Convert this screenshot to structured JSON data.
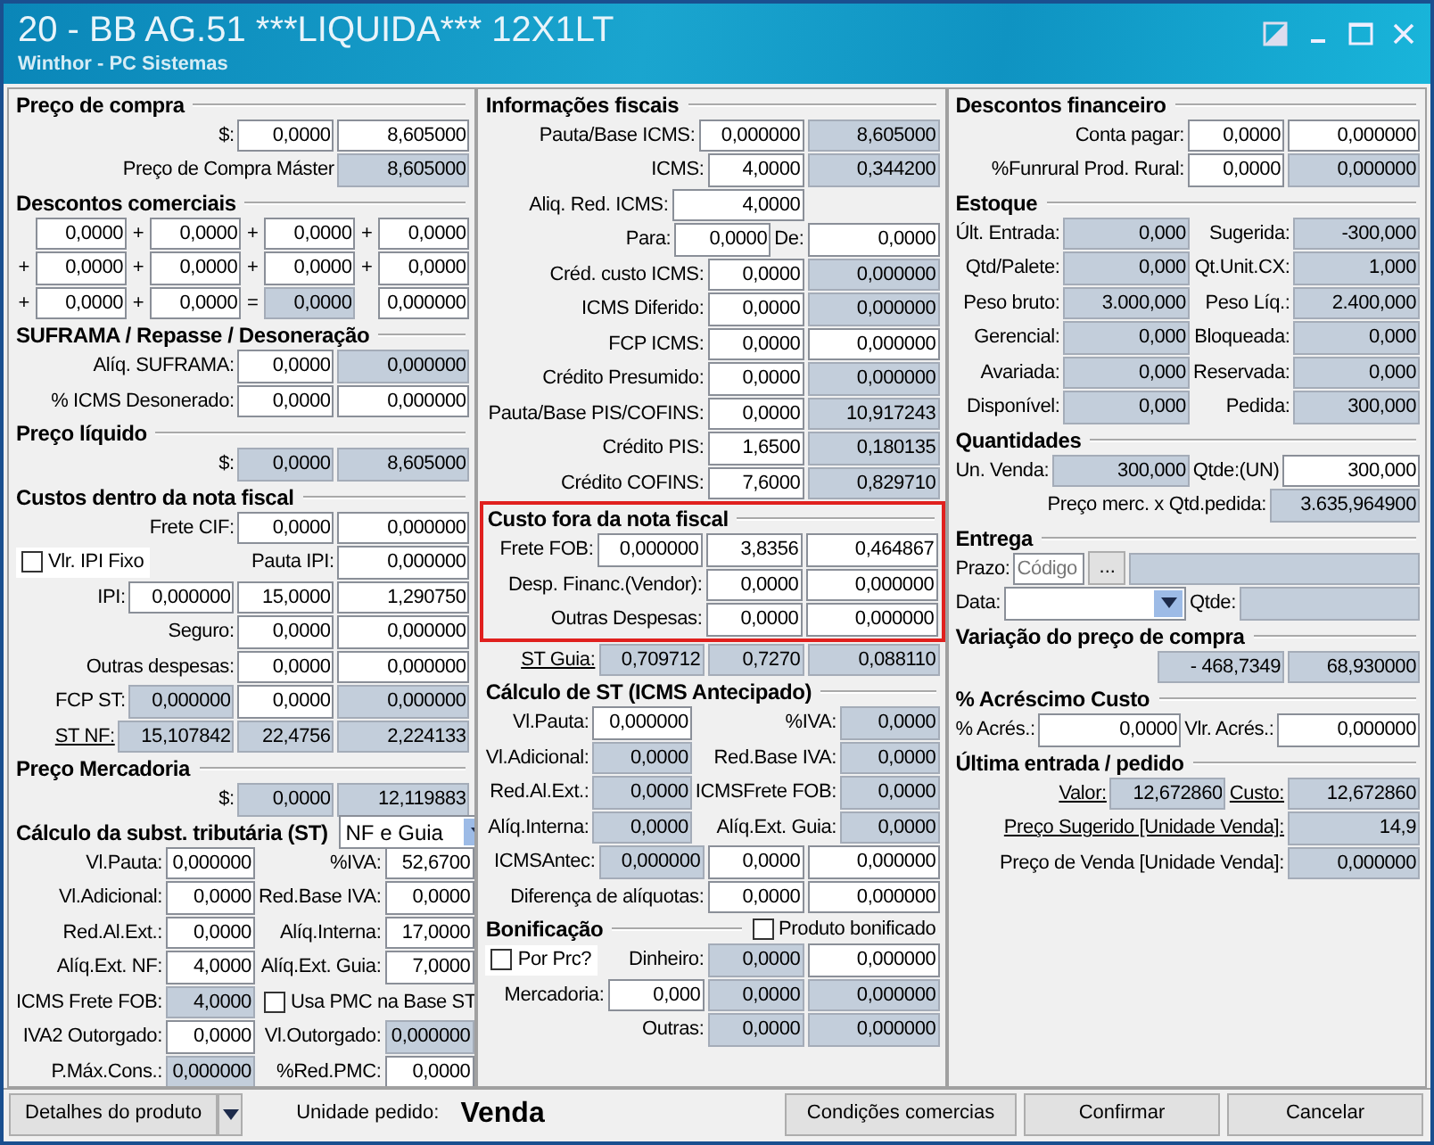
{
  "window": {
    "title": "20 - BB AG.51 ***LIQUIDA*** 12X1LT",
    "subtitle": "Winthor - PC Sistemas"
  },
  "columns": [
    {
      "sections": [
        {
          "title": "Preço de compra",
          "lines": [
            {
              "items": [
                {
                  "kind": "label",
                  "text": "$:"
                },
                {
                  "kind": "field",
                  "value": "0,0000",
                  "readonly": false
                },
                {
                  "kind": "field",
                  "value": "8,605000",
                  "readonly": false
                }
              ]
            },
            {
              "items": [
                {
                  "kind": "label",
                  "text": "Preço de Compra Máster"
                },
                {
                  "kind": "field",
                  "value": "8,605000",
                  "readonly": true
                }
              ]
            }
          ]
        },
        {
          "title": "Descontos comerciais",
          "lines": [
            {
              "items": [
                {
                  "kind": "field",
                  "value": "0,0000",
                  "readonly": false
                },
                {
                  "kind": "op",
                  "text": "+"
                },
                {
                  "kind": "field",
                  "value": "0,0000",
                  "readonly": false
                },
                {
                  "kind": "op",
                  "text": "+"
                },
                {
                  "kind": "field",
                  "value": "0,0000",
                  "readonly": false
                },
                {
                  "kind": "op",
                  "text": "+"
                },
                {
                  "kind": "field",
                  "value": "0,0000",
                  "readonly": false
                }
              ]
            },
            {
              "items": [
                {
                  "kind": "op",
                  "text": "+"
                },
                {
                  "kind": "field",
                  "value": "0,0000",
                  "readonly": false
                },
                {
                  "kind": "op",
                  "text": "+"
                },
                {
                  "kind": "field",
                  "value": "0,0000",
                  "readonly": false
                },
                {
                  "kind": "op",
                  "text": "+"
                },
                {
                  "kind": "field",
                  "value": "0,0000",
                  "readonly": false
                },
                {
                  "kind": "op",
                  "text": "+"
                },
                {
                  "kind": "field",
                  "value": "0,0000",
                  "readonly": false
                }
              ]
            },
            {
              "items": [
                {
                  "kind": "op",
                  "text": "+"
                },
                {
                  "kind": "field",
                  "value": "0,0000",
                  "readonly": false
                },
                {
                  "kind": "op",
                  "text": "+"
                },
                {
                  "kind": "field",
                  "value": "0,0000",
                  "readonly": false
                },
                {
                  "kind": "op",
                  "text": "="
                },
                {
                  "kind": "field",
                  "value": "0,0000",
                  "readonly": true
                },
                {
                  "kind": "field",
                  "value": "0,000000",
                  "readonly": false
                }
              ]
            }
          ]
        },
        {
          "title": "SUFRAMA / Repasse / Desoneração",
          "lines": [
            {
              "items": [
                {
                  "kind": "label",
                  "text": "Alíq. SUFRAMA:"
                },
                {
                  "kind": "field",
                  "value": "0,0000",
                  "readonly": false
                },
                {
                  "kind": "field",
                  "value": "0,000000",
                  "readonly": true
                }
              ]
            },
            {
              "items": [
                {
                  "kind": "label",
                  "text": "% ICMS Desonerado:"
                },
                {
                  "kind": "field",
                  "value": "0,0000",
                  "readonly": false
                },
                {
                  "kind": "field",
                  "value": "0,000000",
                  "readonly": false
                }
              ]
            }
          ]
        },
        {
          "title": "Preço líquido",
          "lines": [
            {
              "items": [
                {
                  "kind": "label",
                  "text": "$:"
                },
                {
                  "kind": "field",
                  "value": "0,0000",
                  "readonly": true
                },
                {
                  "kind": "field",
                  "value": "8,605000",
                  "readonly": true
                }
              ]
            }
          ]
        },
        {
          "title": "Custos dentro da nota fiscal",
          "lines": [
            {
              "items": [
                {
                  "kind": "label",
                  "text": "Frete CIF:"
                },
                {
                  "kind": "field",
                  "value": "0,0000",
                  "readonly": false
                },
                {
                  "kind": "field",
                  "value": "0,000000",
                  "readonly": false
                }
              ]
            },
            {
              "items": [
                {
                  "kind": "check",
                  "text": "Vlr. IPI Fixo",
                  "checked": false
                },
                {
                  "kind": "label",
                  "text": "Pauta IPI:"
                },
                {
                  "kind": "field",
                  "value": "0,000000",
                  "readonly": false
                }
              ]
            },
            {
              "items": [
                {
                  "kind": "label",
                  "text": "IPI:"
                },
                {
                  "kind": "field",
                  "value": "0,000000",
                  "readonly": false
                },
                {
                  "kind": "field",
                  "value": "15,0000",
                  "readonly": false
                },
                {
                  "kind": "field",
                  "value": "1,290750",
                  "readonly": false
                }
              ]
            },
            {
              "items": [
                {
                  "kind": "label",
                  "text": "Seguro:"
                },
                {
                  "kind": "field",
                  "value": "0,0000",
                  "readonly": false
                },
                {
                  "kind": "field",
                  "value": "0,000000",
                  "readonly": false
                }
              ]
            },
            {
              "items": [
                {
                  "kind": "label",
                  "text": "Outras despesas:"
                },
                {
                  "kind": "field",
                  "value": "0,0000",
                  "readonly": false
                },
                {
                  "kind": "field",
                  "value": "0,000000",
                  "readonly": false
                }
              ]
            },
            {
              "items": [
                {
                  "kind": "label",
                  "text": "FCP ST:"
                },
                {
                  "kind": "field",
                  "value": "0,000000",
                  "readonly": true
                },
                {
                  "kind": "field",
                  "value": "0,0000",
                  "readonly": false
                },
                {
                  "kind": "field",
                  "value": "0,000000",
                  "readonly": true
                }
              ]
            },
            {
              "items": [
                {
                  "kind": "link",
                  "text": "ST NF:"
                },
                {
                  "kind": "field",
                  "value": "15,107842",
                  "readonly": true
                },
                {
                  "kind": "field",
                  "value": "22,4756",
                  "readonly": true
                },
                {
                  "kind": "field",
                  "value": "2,224133",
                  "readonly": true
                }
              ]
            }
          ]
        },
        {
          "title": "Preço Mercadoria",
          "lines": [
            {
              "items": [
                {
                  "kind": "label",
                  "text": "$:"
                },
                {
                  "kind": "field",
                  "value": "0,0000",
                  "readonly": true
                },
                {
                  "kind": "field",
                  "value": "12,119883",
                  "readonly": true
                }
              ]
            }
          ]
        },
        {
          "title": "Cálculo da subst. tributária (ST)",
          "combo": "NF e Guia",
          "lines": [
            {
              "items": [
                {
                  "kind": "label",
                  "text": "Vl.Pauta:"
                },
                {
                  "kind": "field",
                  "value": "0,000000",
                  "readonly": false
                },
                {
                  "kind": "label",
                  "text": "%IVA:"
                },
                {
                  "kind": "field",
                  "value": "52,6700",
                  "readonly": false
                }
              ]
            },
            {
              "items": [
                {
                  "kind": "label",
                  "text": "Vl.Adicional:"
                },
                {
                  "kind": "field",
                  "value": "0,0000",
                  "readonly": false
                },
                {
                  "kind": "label",
                  "text": "Red.Base IVA:"
                },
                {
                  "kind": "field",
                  "value": "0,0000",
                  "readonly": false
                }
              ]
            },
            {
              "items": [
                {
                  "kind": "label",
                  "text": "Red.Al.Ext.:"
                },
                {
                  "kind": "field",
                  "value": "0,0000",
                  "readonly": false
                },
                {
                  "kind": "label",
                  "text": "Alíq.Interna:"
                },
                {
                  "kind": "field",
                  "value": "17,0000",
                  "readonly": false
                }
              ]
            },
            {
              "items": [
                {
                  "kind": "label",
                  "text": "Alíq.Ext. NF:"
                },
                {
                  "kind": "field",
                  "value": "4,0000",
                  "readonly": false
                },
                {
                  "kind": "label",
                  "text": "Alíq.Ext. Guia:"
                },
                {
                  "kind": "field",
                  "value": "7,0000",
                  "readonly": false
                }
              ]
            },
            {
              "items": [
                {
                  "kind": "label",
                  "text": "ICMS Frete FOB:"
                },
                {
                  "kind": "field",
                  "value": "4,0000",
                  "readonly": true
                },
                {
                  "kind": "check",
                  "text": "Usa PMC na Base ST",
                  "checked": false
                }
              ]
            },
            {
              "items": [
                {
                  "kind": "label",
                  "text": "IVA2 Outorgado:"
                },
                {
                  "kind": "field",
                  "value": "0,0000",
                  "readonly": false
                },
                {
                  "kind": "label",
                  "text": "Vl.Outorgado:"
                },
                {
                  "kind": "field",
                  "value": "0,000000",
                  "readonly": true
                }
              ]
            },
            {
              "items": [
                {
                  "kind": "label",
                  "text": "P.Máx.Cons.:"
                },
                {
                  "kind": "field",
                  "value": "0,000000",
                  "readonly": true
                },
                {
                  "kind": "label",
                  "text": "%Red.PMC:"
                },
                {
                  "kind": "field",
                  "value": "0,0000",
                  "readonly": false
                }
              ]
            }
          ]
        }
      ]
    },
    {
      "sections": [
        {
          "title": "Informações fiscais",
          "lines": [
            {
              "items": [
                {
                  "kind": "label",
                  "text": "Pauta/Base ICMS:"
                },
                {
                  "kind": "field",
                  "value": "0,000000",
                  "readonly": false
                },
                {
                  "kind": "field",
                  "value": "8,605000",
                  "readonly": true
                }
              ]
            },
            {
              "items": [
                {
                  "kind": "label",
                  "text": "ICMS:"
                },
                {
                  "kind": "field",
                  "value": "4,0000",
                  "readonly": false
                },
                {
                  "kind": "field",
                  "value": "0,344200",
                  "readonly": true
                }
              ]
            },
            {
              "items": [
                {
                  "kind": "label",
                  "text": "Aliq. Red. ICMS:"
                },
                {
                  "kind": "field",
                  "value": "4,0000",
                  "readonly": false
                }
              ]
            },
            {
              "items": [
                {
                  "kind": "label",
                  "text": "Para:"
                },
                {
                  "kind": "field",
                  "value": "0,0000",
                  "readonly": false
                },
                {
                  "kind": "label",
                  "text": "De:"
                },
                {
                  "kind": "field",
                  "value": "0,0000",
                  "readonly": false
                }
              ]
            },
            {
              "items": [
                {
                  "kind": "label",
                  "text": "Créd. custo ICMS:"
                },
                {
                  "kind": "field",
                  "value": "0,0000",
                  "readonly": false
                },
                {
                  "kind": "field",
                  "value": "0,000000",
                  "readonly": true
                }
              ]
            },
            {
              "items": [
                {
                  "kind": "label",
                  "text": "ICMS Diferido:"
                },
                {
                  "kind": "field",
                  "value": "0,0000",
                  "readonly": false
                },
                {
                  "kind": "field",
                  "value": "0,000000",
                  "readonly": true
                }
              ]
            },
            {
              "items": [
                {
                  "kind": "label",
                  "text": "FCP ICMS:"
                },
                {
                  "kind": "field",
                  "value": "0,0000",
                  "readonly": false
                },
                {
                  "kind": "field",
                  "value": "0,000000",
                  "readonly": false
                }
              ]
            },
            {
              "items": [
                {
                  "kind": "label",
                  "text": "Crédito Presumido:"
                },
                {
                  "kind": "field",
                  "value": "0,0000",
                  "readonly": false
                },
                {
                  "kind": "field",
                  "value": "0,000000",
                  "readonly": true
                }
              ]
            },
            {
              "items": [
                {
                  "kind": "label",
                  "text": "Pauta/Base PIS/COFINS:"
                },
                {
                  "kind": "field",
                  "value": "0,0000",
                  "readonly": false
                },
                {
                  "kind": "field",
                  "value": "10,917243",
                  "readonly": true
                }
              ]
            },
            {
              "items": [
                {
                  "kind": "label",
                  "text": "Crédito PIS:"
                },
                {
                  "kind": "field",
                  "value": "1,6500",
                  "readonly": false
                },
                {
                  "kind": "field",
                  "value": "0,180135",
                  "readonly": true
                }
              ]
            },
            {
              "items": [
                {
                  "kind": "label",
                  "text": "Crédito COFINS:"
                },
                {
                  "kind": "field",
                  "value": "7,6000",
                  "readonly": false
                },
                {
                  "kind": "field",
                  "value": "0,829710",
                  "readonly": true
                }
              ]
            }
          ]
        },
        {
          "title": "Custo fora da nota fiscal",
          "highlighted": true,
          "lines": [
            {
              "items": [
                {
                  "kind": "label",
                  "text": "Frete FOB:"
                },
                {
                  "kind": "field",
                  "value": "0,000000",
                  "readonly": false
                },
                {
                  "kind": "field",
                  "value": "3,8356",
                  "readonly": false
                },
                {
                  "kind": "field",
                  "value": "0,464867",
                  "readonly": false
                }
              ]
            },
            {
              "items": [
                {
                  "kind": "label",
                  "text": "Desp. Financ.(Vendor):"
                },
                {
                  "kind": "field",
                  "value": "0,0000",
                  "readonly": false
                },
                {
                  "kind": "field",
                  "value": "0,000000",
                  "readonly": false
                }
              ]
            },
            {
              "items": [
                {
                  "kind": "label",
                  "text": "Outras Despesas:"
                },
                {
                  "kind": "field",
                  "value": "0,0000",
                  "readonly": false
                },
                {
                  "kind": "field",
                  "value": "0,000000",
                  "readonly": false
                }
              ]
            }
          ]
        },
        {
          "lines": [
            {
              "items": [
                {
                  "kind": "link",
                  "text": "ST Guia:"
                },
                {
                  "kind": "field",
                  "value": "0,709712",
                  "readonly": true
                },
                {
                  "kind": "field",
                  "value": "0,7270",
                  "readonly": true
                },
                {
                  "kind": "field",
                  "value": "0,088110",
                  "readonly": true
                }
              ]
            }
          ]
        },
        {
          "title": "Cálculo de ST (ICMS Antecipado)",
          "lines": [
            {
              "items": [
                {
                  "kind": "label",
                  "text": "Vl.Pauta:"
                },
                {
                  "kind": "field",
                  "value": "0,000000",
                  "readonly": false
                },
                {
                  "kind": "label",
                  "text": "%IVA:"
                },
                {
                  "kind": "field",
                  "value": "0,0000",
                  "readonly": true
                }
              ]
            },
            {
              "items": [
                {
                  "kind": "label",
                  "text": "Vl.Adicional:"
                },
                {
                  "kind": "field",
                  "value": "0,0000",
                  "readonly": true
                },
                {
                  "kind": "label",
                  "text": "Red.Base IVA:"
                },
                {
                  "kind": "field",
                  "value": "0,0000",
                  "readonly": true
                }
              ]
            },
            {
              "items": [
                {
                  "kind": "label",
                  "text": "Red.Al.Ext.:"
                },
                {
                  "kind": "field",
                  "value": "0,0000",
                  "readonly": true
                },
                {
                  "kind": "label",
                  "text": "ICMSFrete FOB:"
                },
                {
                  "kind": "field",
                  "value": "0,0000",
                  "readonly": true
                }
              ]
            },
            {
              "items": [
                {
                  "kind": "label",
                  "text": "Alíq.Interna:"
                },
                {
                  "kind": "field",
                  "value": "0,0000",
                  "readonly": true
                },
                {
                  "kind": "label",
                  "text": "Alíq.Ext. Guia:"
                },
                {
                  "kind": "field",
                  "value": "0,0000",
                  "readonly": true
                }
              ]
            },
            {
              "items": [
                {
                  "kind": "label",
                  "text": "ICMSAntec:"
                },
                {
                  "kind": "field",
                  "value": "0,000000",
                  "readonly": true
                },
                {
                  "kind": "field",
                  "value": "0,0000",
                  "readonly": false
                },
                {
                  "kind": "field",
                  "value": "0,000000",
                  "readonly": false
                }
              ]
            },
            {
              "items": [
                {
                  "kind": "label",
                  "text": "Diferença de alíquotas:"
                },
                {
                  "kind": "field",
                  "value": "0,0000",
                  "readonly": false
                },
                {
                  "kind": "field",
                  "value": "0,000000",
                  "readonly": false
                }
              ]
            }
          ]
        },
        {
          "title": "Bonificação",
          "header_check": {
            "text": "Produto bonificado",
            "checked": false
          },
          "lines": [
            {
              "items": [
                {
                  "kind": "check",
                  "text": "Por Prc?",
                  "checked": false
                },
                {
                  "kind": "label",
                  "text": "Dinheiro:"
                },
                {
                  "kind": "field",
                  "value": "0,0000",
                  "readonly": true
                },
                {
                  "kind": "field",
                  "value": "0,000000",
                  "readonly": false
                }
              ]
            },
            {
              "items": [
                {
                  "kind": "label",
                  "text": "Mercadoria:"
                },
                {
                  "kind": "field",
                  "value": "0,000",
                  "readonly": false
                },
                {
                  "kind": "field",
                  "value": "0,0000",
                  "readonly": true
                },
                {
                  "kind": "field",
                  "value": "0,000000",
                  "readonly": true
                }
              ]
            },
            {
              "items": [
                {
                  "kind": "label",
                  "text": "Outras:"
                },
                {
                  "kind": "field",
                  "value": "0,0000",
                  "readonly": true
                },
                {
                  "kind": "field",
                  "value": "0,000000",
                  "readonly": true
                }
              ]
            }
          ]
        }
      ]
    },
    {
      "sections": [
        {
          "title": "Descontos financeiro",
          "lines": [
            {
              "items": [
                {
                  "kind": "label",
                  "text": "Conta pagar:"
                },
                {
                  "kind": "field",
                  "value": "0,0000",
                  "readonly": false
                },
                {
                  "kind": "field",
                  "value": "0,000000",
                  "readonly": false
                }
              ]
            },
            {
              "items": [
                {
                  "kind": "label",
                  "text": "%Funrural Prod. Rural:"
                },
                {
                  "kind": "field",
                  "value": "0,0000",
                  "readonly": false
                },
                {
                  "kind": "field",
                  "value": "0,000000",
                  "readonly": true
                }
              ]
            }
          ]
        },
        {
          "title": "Estoque",
          "lines": [
            {
              "items": [
                {
                  "kind": "label",
                  "text": "Últ. Entrada:"
                },
                {
                  "kind": "field",
                  "value": "0,000",
                  "readonly": true
                },
                {
                  "kind": "label",
                  "text": "Sugerida:"
                },
                {
                  "kind": "field",
                  "value": "-300,000",
                  "readonly": true
                }
              ]
            },
            {
              "items": [
                {
                  "kind": "label",
                  "text": "Qtd/Palete:"
                },
                {
                  "kind": "field",
                  "value": "0,000",
                  "readonly": true
                },
                {
                  "kind": "label",
                  "text": "Qt.Unit.CX:"
                },
                {
                  "kind": "field",
                  "value": "1,000",
                  "readonly": true
                }
              ]
            },
            {
              "items": [
                {
                  "kind": "label",
                  "text": "Peso bruto:"
                },
                {
                  "kind": "field",
                  "value": "3.000,000",
                  "readonly": true
                },
                {
                  "kind": "label",
                  "text": "Peso Líq.:"
                },
                {
                  "kind": "field",
                  "value": "2.400,000",
                  "readonly": true
                }
              ]
            },
            {
              "items": [
                {
                  "kind": "label",
                  "text": "Gerencial:"
                },
                {
                  "kind": "field",
                  "value": "0,000",
                  "readonly": true
                },
                {
                  "kind": "label",
                  "text": "Bloqueada:"
                },
                {
                  "kind": "field",
                  "value": "0,000",
                  "readonly": true
                }
              ]
            },
            {
              "items": [
                {
                  "kind": "label",
                  "text": "Avariada:"
                },
                {
                  "kind": "field",
                  "value": "0,000",
                  "readonly": true
                },
                {
                  "kind": "label",
                  "text": "Reservada:"
                },
                {
                  "kind": "field",
                  "value": "0,000",
                  "readonly": true
                }
              ]
            },
            {
              "items": [
                {
                  "kind": "label",
                  "text": "Disponível:"
                },
                {
                  "kind": "field",
                  "value": "0,000",
                  "readonly": true
                },
                {
                  "kind": "label",
                  "text": "Pedida:"
                },
                {
                  "kind": "field",
                  "value": "300,000",
                  "readonly": true
                }
              ]
            }
          ]
        },
        {
          "title": "Quantidades",
          "lines": [
            {
              "items": [
                {
                  "kind": "label",
                  "text": "Un. Venda:"
                },
                {
                  "kind": "field",
                  "value": "300,000",
                  "readonly": true
                },
                {
                  "kind": "label",
                  "text": "Qtde:(UN)"
                },
                {
                  "kind": "field",
                  "value": "300,000",
                  "readonly": false
                }
              ]
            }
          ]
        },
        {
          "lines": [
            {
              "items": [
                {
                  "kind": "label",
                  "text": "Preço merc. x Qtd.pedida:"
                },
                {
                  "kind": "field",
                  "value": "3.635,964900",
                  "readonly": true
                }
              ]
            }
          ]
        },
        {
          "title": "Entrega",
          "lines": [
            {
              "items": [
                {
                  "kind": "label",
                  "text": "Prazo:"
                },
                {
                  "kind": "field",
                  "placeholder": "Código",
                  "readonly": false
                },
                {
                  "kind": "button",
                  "text": "..."
                },
                {
                  "kind": "field",
                  "readonly": true
                }
              ]
            },
            {
              "items": [
                {
                  "kind": "label",
                  "text": "Data:"
                },
                {
                  "kind": "combo"
                },
                {
                  "kind": "label",
                  "text": "Qtde:"
                },
                {
                  "kind": "field",
                  "readonly": true
                }
              ]
            }
          ]
        },
        {
          "title": "Variação do preço de compra",
          "lines": [
            {
              "items": [
                {
                  "kind": "field",
                  "value": "- 468,7349",
                  "readonly": true
                },
                {
                  "kind": "field",
                  "value": "68,930000",
                  "readonly": true
                }
              ]
            }
          ]
        },
        {
          "title": "% Acréscimo Custo",
          "lines": [
            {
              "items": [
                {
                  "kind": "label",
                  "text": "% Acrés.:"
                },
                {
                  "kind": "field",
                  "value": "0,0000",
                  "readonly": false
                },
                {
                  "kind": "label",
                  "text": "Vlr. Acrés.:"
                },
                {
                  "kind": "field",
                  "value": "0,000000",
                  "readonly": false
                }
              ]
            }
          ]
        },
        {
          "title": "Última entrada / pedido",
          "lines": [
            {
              "items": [
                {
                  "kind": "link",
                  "text": "Valor:"
                },
                {
                  "kind": "field",
                  "value": "12,672860",
                  "readonly": true
                },
                {
                  "kind": "link",
                  "text": "Custo:"
                },
                {
                  "kind": "field",
                  "value": "12,672860",
                  "readonly": true
                }
              ]
            },
            {
              "items": [
                {
                  "kind": "link",
                  "text": "Preço Sugerido [Unidade Venda]:"
                },
                {
                  "kind": "field",
                  "value": "14,9",
                  "readonly": true
                }
              ]
            },
            {
              "items": [
                {
                  "kind": "label",
                  "text": "Preço de Venda [Unidade Venda]:"
                },
                {
                  "kind": "field",
                  "value": "0,000000",
                  "readonly": true
                }
              ]
            }
          ]
        }
      ]
    }
  ],
  "footer": {
    "detail_button": "Detalhes do produto",
    "unit_label": "Unidade pedido:",
    "unit_value": "Venda",
    "buttons": [
      "Condições comercias",
      "Confirmar",
      "Cancelar"
    ]
  }
}
